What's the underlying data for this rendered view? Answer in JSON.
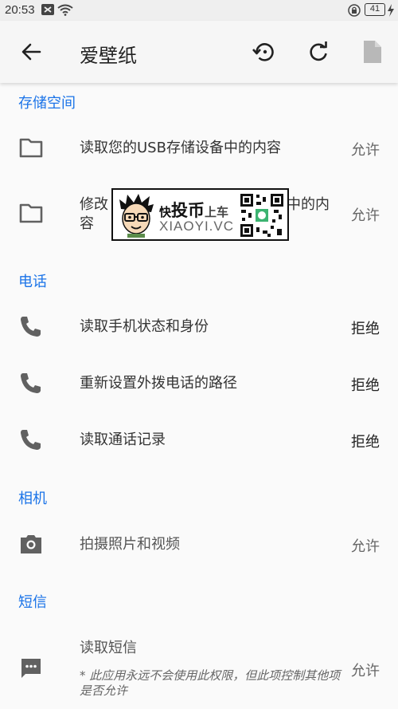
{
  "status_bar": {
    "time": "20:53",
    "battery": "41"
  },
  "app_bar": {
    "title": "爱壁纸"
  },
  "sections": {
    "storage": {
      "title": "存储空间"
    },
    "phone": {
      "title": "电话"
    },
    "camera": {
      "title": "相机"
    },
    "sms": {
      "title": "短信"
    }
  },
  "rows": {
    "usb_read": {
      "label": "读取您的USB存储设备中的内容",
      "status": "允许"
    },
    "usb_write": {
      "label_visible": "修改",
      "label_tail": "中的内",
      "label_line2": "容",
      "status": "允许"
    },
    "phone_state": {
      "label": "读取手机状态和身份",
      "status": "拒绝"
    },
    "call_route": {
      "label": "重新设置外拨电话的路径",
      "status": "拒绝"
    },
    "call_log": {
      "label": "读取通话记录",
      "status": "拒绝"
    },
    "camera": {
      "label": "拍摄照片和视频",
      "status": "允许"
    },
    "sms_read": {
      "label": "读取短信",
      "status": "允许",
      "note": "* 此应用永远不会使用此权限，但此项控制其他项是否允许"
    }
  },
  "watermark": {
    "line1_a": "快",
    "line1_b": "投币",
    "line1_c": "上车",
    "line2": "XIAOYI.VC"
  },
  "icons": {
    "back": "arrow-left-icon",
    "history": "history-icon",
    "refresh": "refresh-icon",
    "file": "file-icon",
    "folder": "folder-icon",
    "phone": "phone-icon",
    "camera": "camera-icon",
    "sms": "sms-icon"
  },
  "colors": {
    "accent": "#1a73e8",
    "icon": "#616161",
    "background": "#fafafa"
  }
}
